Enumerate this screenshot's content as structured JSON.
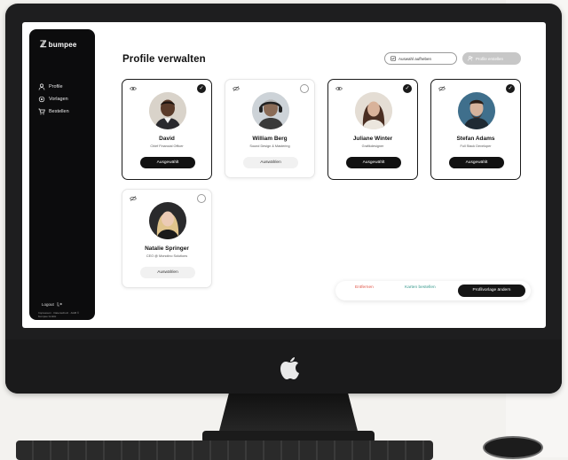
{
  "app": {
    "logo_text": "bumpee",
    "logo_mark": "ℤ"
  },
  "sidebar": {
    "items": [
      {
        "label": "Profile",
        "icon": "profile-icon"
      },
      {
        "label": "Vorlagen",
        "icon": "templates-icon"
      },
      {
        "label": "Bestellen",
        "icon": "cart-icon"
      }
    ],
    "logout_label": "Logout",
    "legal_text": "Impressum · Datenschutz · AGB © bumpee GmbH"
  },
  "header": {
    "title": "Profile verwalten",
    "btn_remove_selection": "Auswahl aufheben",
    "btn_add_profile": "Profile erstellen"
  },
  "profiles": [
    {
      "name": "David",
      "role": "Chief Financial Officer",
      "selected": true,
      "button": "Ausgewählt"
    },
    {
      "name": "William Berg",
      "role": "Sound Design & Mastering",
      "selected": false,
      "button": "Auswählen"
    },
    {
      "name": "Juliane Winter",
      "role": "Grafikdesigner",
      "selected": true,
      "button": "Ausgewählt"
    },
    {
      "name": "Stefan Adams",
      "role": "Full Stack Developer",
      "selected": true,
      "button": "Ausgewählt"
    },
    {
      "name": "Natalie Springer",
      "role": "CEO @ Monolino Solutions",
      "selected": false,
      "button": "Auswählen"
    }
  ],
  "actions": {
    "remove": "Entfernen",
    "edit_cards": "Karten bestellen",
    "change_template": "Profilvorlage ändern"
  },
  "colors": {
    "sidebar_bg": "#0c0c0d",
    "primary": "#111111",
    "danger": "#e05547",
    "teal": "#3a9a8e"
  }
}
